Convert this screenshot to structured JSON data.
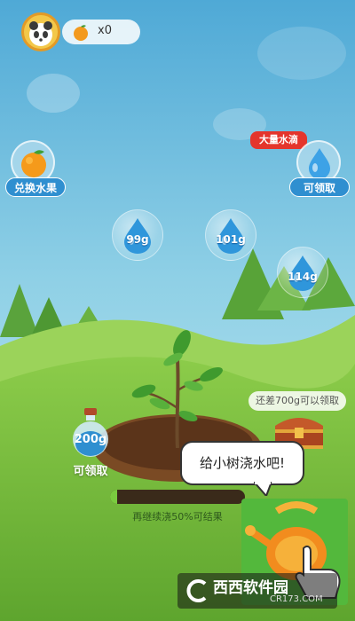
{
  "header": {
    "fruit_count": "x0"
  },
  "left_widget": {
    "label": "兑换水果"
  },
  "right_widget": {
    "tag": "大量水滴",
    "label": "可领取"
  },
  "water_drops": [
    {
      "value": "99g"
    },
    {
      "value": "101g"
    },
    {
      "value": "114g"
    }
  ],
  "bottle": {
    "value": "200g",
    "label": "可领取"
  },
  "chest": {
    "label": "还差700g可以领取"
  },
  "progress": {
    "label": "再继续浇50%可结果",
    "fraction": 0.05
  },
  "speech": {
    "text": "给小树浇水吧!"
  },
  "watermark": {
    "text": "西西软件园",
    "url": "CR173.COM"
  },
  "colors": {
    "sky": "#5fb5d8",
    "grass": "#7ec23f",
    "accent_blue": "#2f8fd0",
    "tag_red": "#e4352c"
  }
}
